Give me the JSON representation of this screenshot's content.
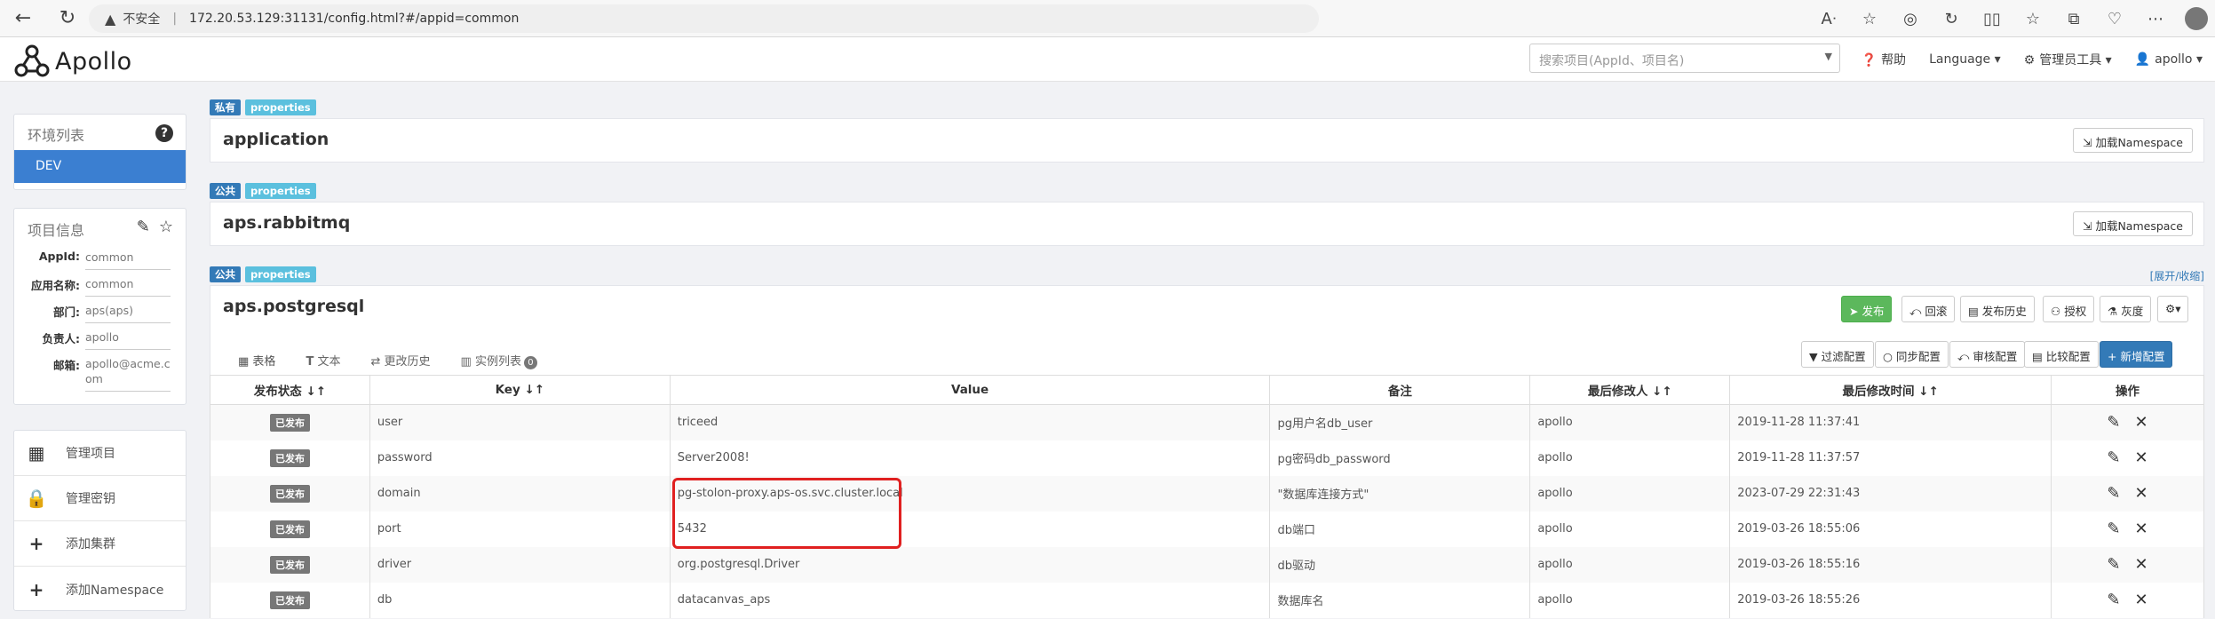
{
  "browser": {
    "insecure_label": "不安全",
    "url": "172.20.53.129:31131/config.html?#/appid=common"
  },
  "app": {
    "logo_text": "Apollo",
    "search_placeholder": "搜索项目(AppId、项目名)",
    "nav": {
      "help": "帮助",
      "language": "Language",
      "admin_tools": "管理员工具",
      "user": "apollo"
    }
  },
  "sidebar": {
    "env_title": "环境列表",
    "env_selected": "DEV",
    "info_title": "项目信息",
    "info": [
      {
        "key": "AppId:",
        "value": "common"
      },
      {
        "key": "应用名称:",
        "value": "common"
      },
      {
        "key": "部门:",
        "value": "aps(aps)"
      },
      {
        "key": "负责人:",
        "value": "apollo"
      },
      {
        "key": "邮箱:",
        "value": "apollo@acme.com"
      }
    ],
    "menu": [
      {
        "label": "管理项目",
        "icon": "grid-icon"
      },
      {
        "label": "管理密钥",
        "icon": "lock-icon"
      },
      {
        "label": "添加集群",
        "icon": "plus-icon"
      },
      {
        "label": "添加Namespace",
        "icon": "plus-icon"
      }
    ]
  },
  "namespaces": [
    {
      "scope": "私有",
      "format": "properties",
      "name": "application",
      "load_label": "加载Namespace"
    },
    {
      "scope": "公共",
      "format": "properties",
      "name": "aps.rabbitmq",
      "load_label": "加载Namespace"
    },
    {
      "scope": "公共",
      "format": "properties",
      "name": "aps.postgresql",
      "expand_label": "[展开/收缩]"
    }
  ],
  "actions": {
    "publish": "发布",
    "rollback": "回滚",
    "history": "发布历史",
    "auth": "授权",
    "gray": "灰度",
    "settings": "⚙▾",
    "filter": "过滤配置",
    "sync": "同步配置",
    "diff_sync": "审核配置",
    "compare": "比较配置",
    "add": "+ 新增配置"
  },
  "tabs": {
    "table": "表格",
    "text": "文本",
    "history": "更改历史",
    "instances": "实例列表",
    "instances_count": "0"
  },
  "table": {
    "headers": [
      "发布状态 ↓↑",
      "Key ↓↑",
      "Value",
      "备注",
      "最后修改人 ↓↑",
      "最后修改时间 ↓↑",
      "操作"
    ],
    "rows": [
      {
        "status": "已发布",
        "key": "user",
        "value": "triceed",
        "comment": "pg用户名db_user",
        "modifier": "apollo",
        "time": "2019-11-28 11:37:41"
      },
      {
        "status": "已发布",
        "key": "password",
        "value": "Server2008!",
        "comment": "pg密码db_password",
        "modifier": "apollo",
        "time": "2019-11-28 11:37:57"
      },
      {
        "status": "已发布",
        "key": "domain",
        "value": "pg-stolon-proxy.aps-os.svc.cluster.local",
        "comment": "\"数据库连接方式\"",
        "modifier": "apollo",
        "time": "2023-07-29 22:31:43"
      },
      {
        "status": "已发布",
        "key": "port",
        "value": "5432",
        "comment": "db端口",
        "modifier": "apollo",
        "time": "2019-03-26 18:55:06"
      },
      {
        "status": "已发布",
        "key": "driver",
        "value": "org.postgresql.Driver",
        "comment": "db驱动",
        "modifier": "apollo",
        "time": "2019-03-26 18:55:16"
      },
      {
        "status": "已发布",
        "key": "db",
        "value": "datacanvas_aps",
        "comment": "数据库名",
        "modifier": "apollo",
        "time": "2019-03-26 18:55:26"
      }
    ]
  }
}
